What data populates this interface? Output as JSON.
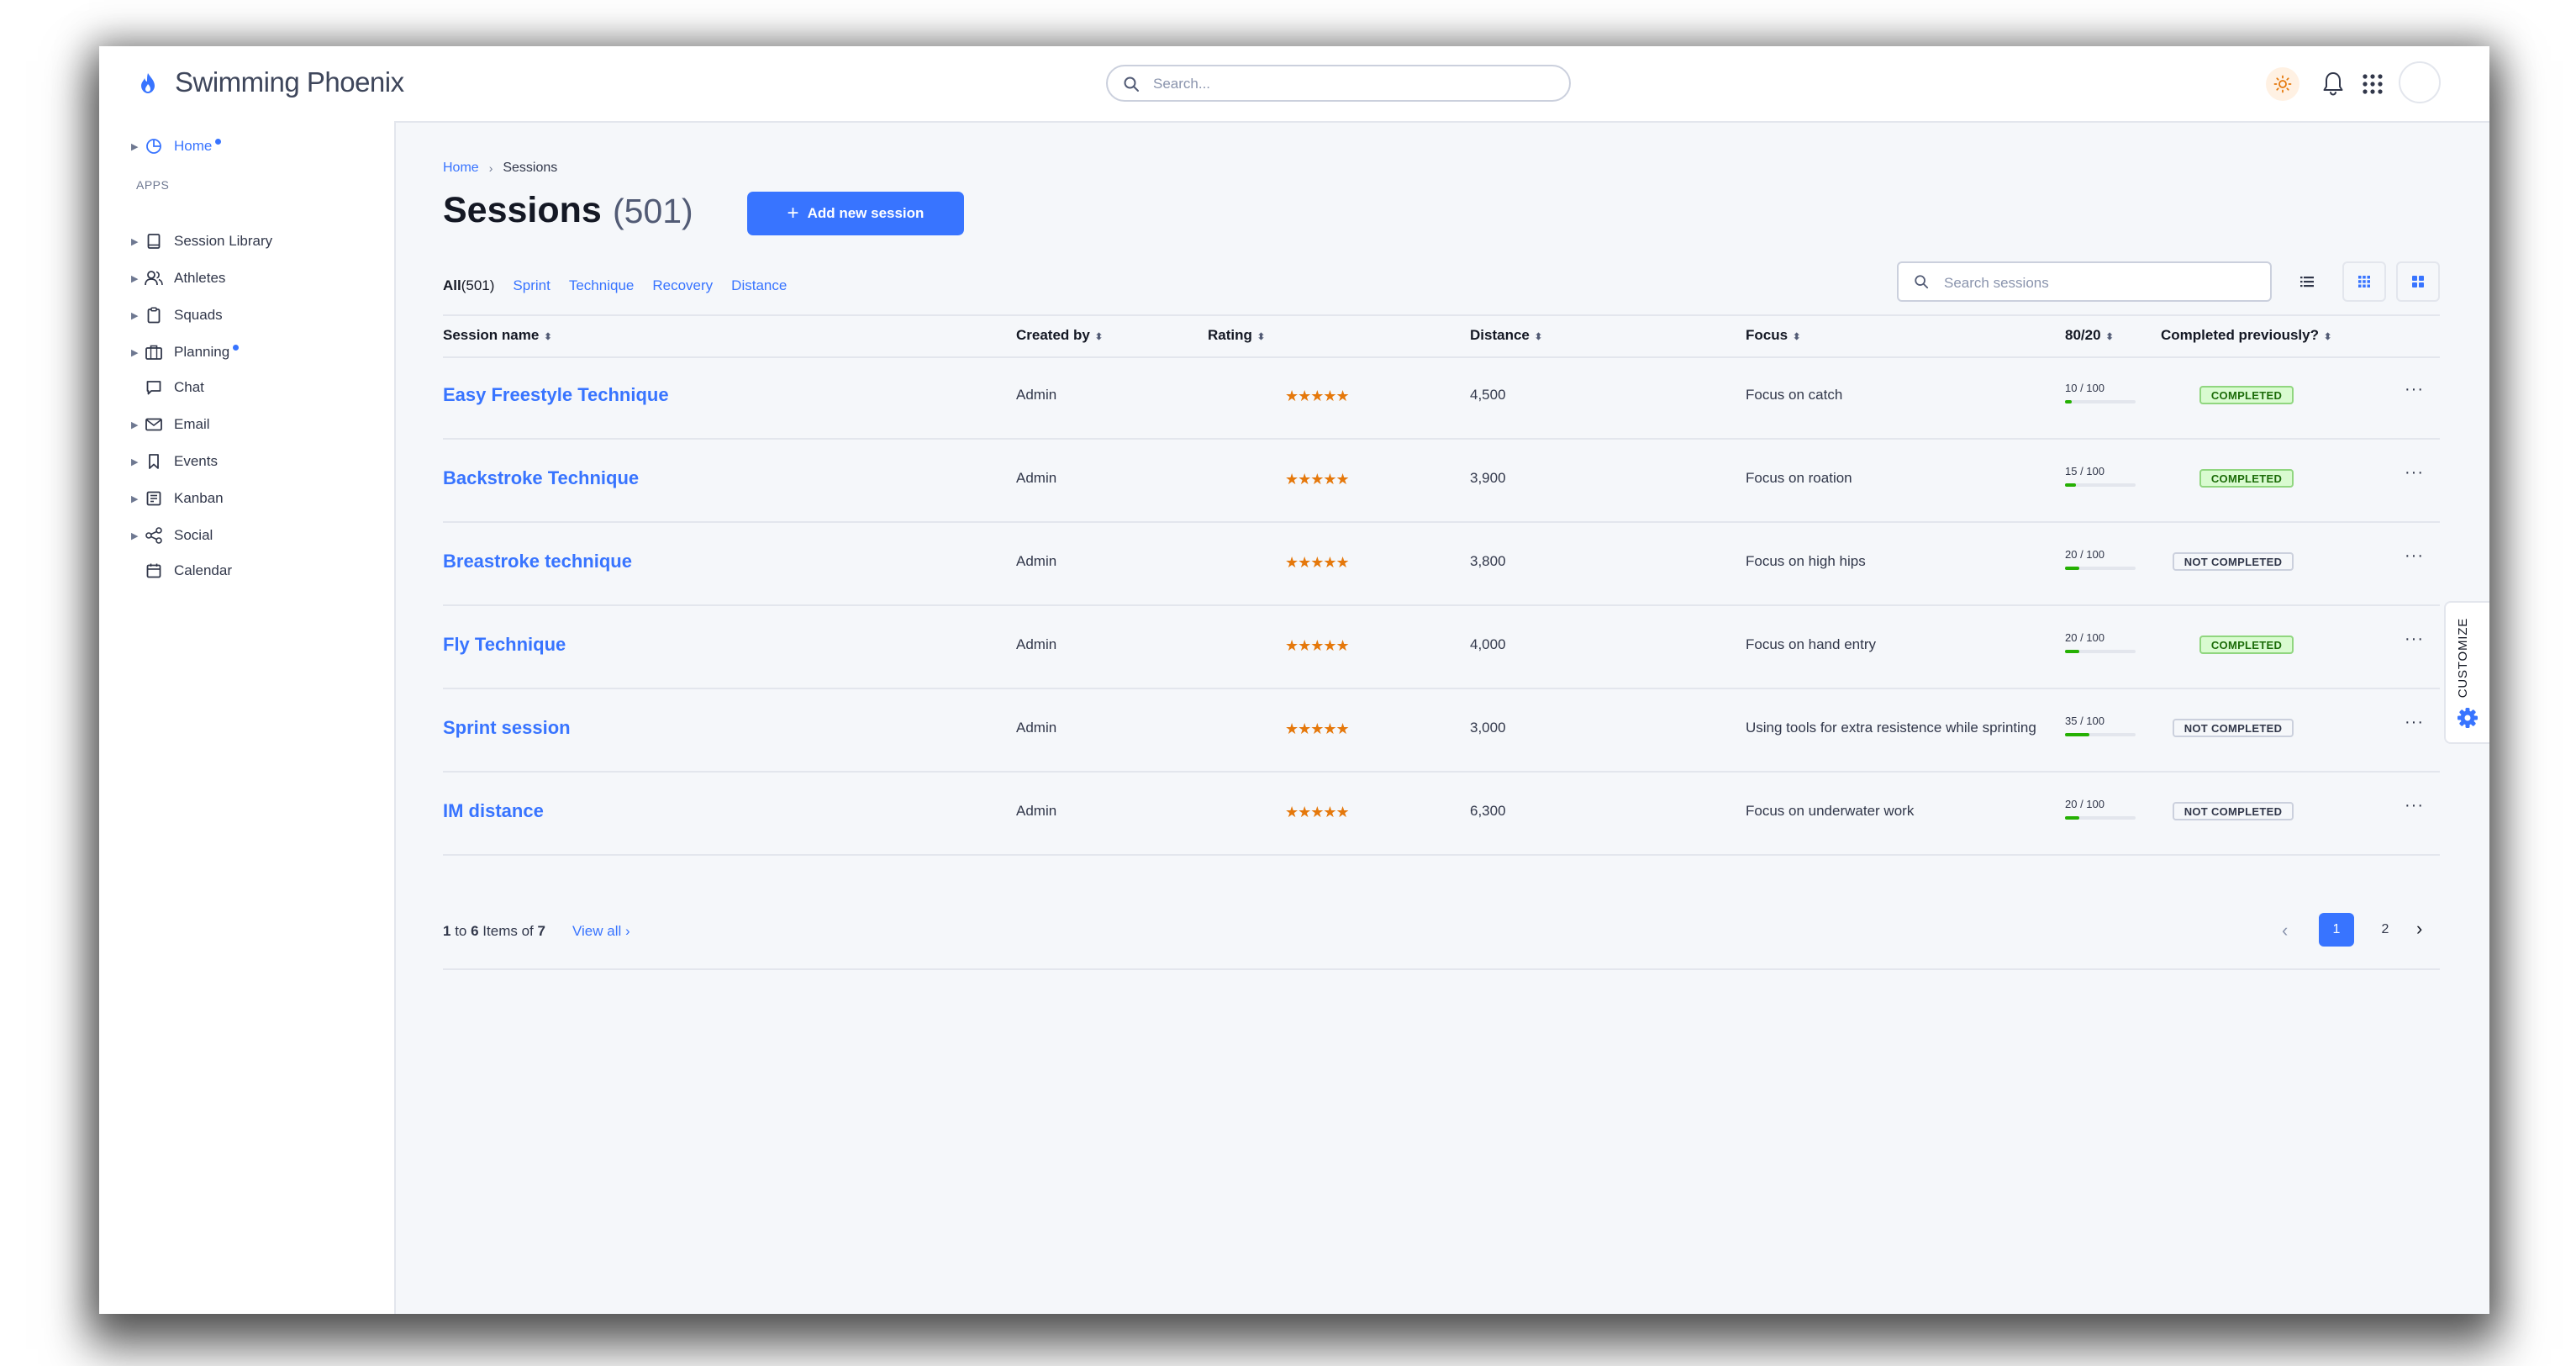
{
  "app": {
    "name": "Swimming Phoenix"
  },
  "topbar": {
    "search_placeholder": "Search..."
  },
  "sidebar": {
    "home": "Home",
    "section_label": "APPS",
    "items": [
      {
        "label": "Session Library",
        "icon": "book-icon"
      },
      {
        "label": "Athletes",
        "icon": "users-icon"
      },
      {
        "label": "Squads",
        "icon": "clipboard-icon"
      },
      {
        "label": "Planning",
        "icon": "briefcase-icon"
      },
      {
        "label": "Chat",
        "icon": "chat-icon"
      },
      {
        "label": "Email",
        "icon": "mail-icon"
      },
      {
        "label": "Events",
        "icon": "bookmark-icon"
      },
      {
        "label": "Kanban",
        "icon": "kanban-icon"
      },
      {
        "label": "Social",
        "icon": "share-icon"
      },
      {
        "label": "Calendar",
        "icon": "calendar-icon"
      }
    ]
  },
  "breadcrumb": {
    "home": "Home",
    "current": "Sessions"
  },
  "page": {
    "title": "Sessions",
    "count": "(501)",
    "add_button": "Add new session"
  },
  "filters": {
    "all_label": "All",
    "all_count": "(501)",
    "links": [
      "Sprint",
      "Technique",
      "Recovery",
      "Distance"
    ]
  },
  "table_search": {
    "placeholder": "Search sessions"
  },
  "table": {
    "headers": [
      "Session name",
      "Created by",
      "Rating",
      "Distance",
      "Focus",
      "80/20",
      "Completed previously?"
    ],
    "rows": [
      {
        "name": "Easy Freestyle Technique",
        "created_by": "Admin",
        "rating": 5,
        "stars": "★★★★★",
        "distance": "4,500",
        "focus": "Focus on catch",
        "ratio": "10 / 100",
        "ratio_value": 0.1,
        "status": "COMPLETED"
      },
      {
        "name": "Backstroke Technique",
        "created_by": "Admin",
        "rating": 5,
        "stars": "★★★★★",
        "distance": "3,900",
        "focus": "Focus on roation",
        "ratio": "15 / 100",
        "ratio_value": 0.15,
        "status": "COMPLETED"
      },
      {
        "name": "Breastroke technique",
        "created_by": "Admin",
        "rating": 5,
        "stars": "★★★★★",
        "distance": "3,800",
        "focus": "Focus on high hips",
        "ratio": "20 / 100",
        "ratio_value": 0.2,
        "status": "NOT COMPLETED"
      },
      {
        "name": "Fly Technique",
        "created_by": "Admin",
        "rating": 5,
        "stars": "★★★★★",
        "distance": "4,000",
        "focus": "Focus on hand entry",
        "ratio": "20 / 100",
        "ratio_value": 0.2,
        "status": "COMPLETED"
      },
      {
        "name": "Sprint session",
        "created_by": "Admin",
        "rating": 5,
        "stars": "★★★★★",
        "distance": "3,000",
        "focus": "Using tools for extra resistence while sprinting",
        "ratio": "35 / 100",
        "ratio_value": 0.35,
        "status": "NOT COMPLETED"
      },
      {
        "name": "IM distance",
        "created_by": "Admin",
        "rating": 5,
        "stars": "★★★★★",
        "distance": "6,300",
        "focus": "Focus on underwater work",
        "ratio": "20 / 100",
        "ratio_value": 0.2,
        "status": "NOT COMPLETED"
      }
    ],
    "more_label": "···"
  },
  "footer": {
    "range_from": "1",
    "range_to": "6",
    "items_label": "Items of",
    "total": "7",
    "view_all": "View all",
    "pages": [
      "1",
      "2"
    ]
  },
  "customize": {
    "label": "CUSTOMIZE"
  },
  "colors": {
    "primary": "#3874ff",
    "success": "#25b003",
    "star": "#e5780b",
    "theme_bg": "#fff1e3"
  }
}
